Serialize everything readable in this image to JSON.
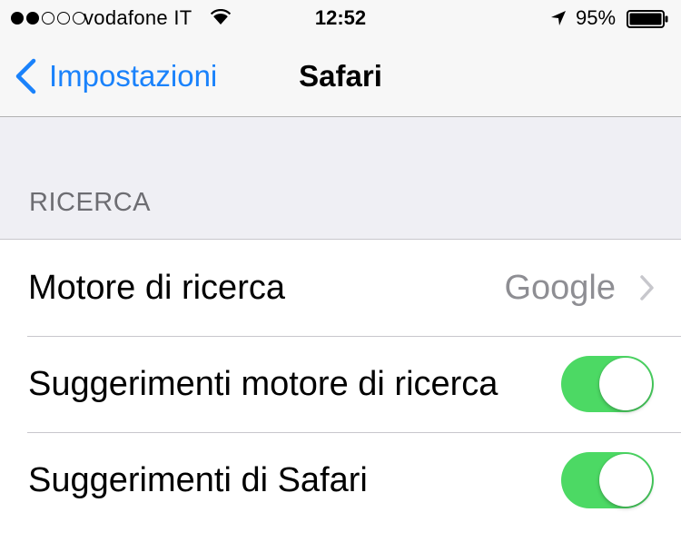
{
  "status_bar": {
    "signal_bars_filled": 2,
    "signal_bars_total": 5,
    "carrier": "vodafone IT",
    "time": "12:52",
    "battery_percent": "95%",
    "battery_level": 0.95
  },
  "nav": {
    "back_label": "Impostazioni",
    "title": "Safari"
  },
  "section": {
    "header": "RICERCA"
  },
  "rows": [
    {
      "label": "Motore di ricerca",
      "value": "Google"
    },
    {
      "label": "Suggerimenti motore di ricerca",
      "toggle_on": true
    },
    {
      "label": "Suggerimenti di Safari",
      "toggle_on": true
    }
  ],
  "colors": {
    "accent": "#1a82fb",
    "toggle_on": "#4cd964",
    "secondary_text": "#8e8e93",
    "background": "#efeff4"
  }
}
